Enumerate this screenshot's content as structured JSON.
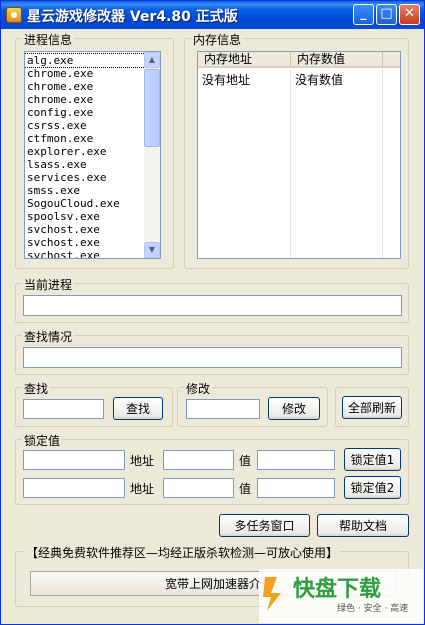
{
  "window": {
    "title": "星云游戏修改器 Ver4.80 正式版",
    "controls": {
      "minimize": "_",
      "maximize": "□",
      "close": "✕"
    }
  },
  "process_group": {
    "label": "进程信息",
    "selected_index": 0,
    "items": [
      "alg.exe",
      "chrome.exe",
      "chrome.exe",
      "chrome.exe",
      "config.exe",
      "csrss.exe",
      "ctfmon.exe",
      "explorer.exe",
      "lsass.exe",
      "services.exe",
      "smss.exe",
      "SogouCloud.exe",
      "spoolsv.exe",
      "svchost.exe",
      "svchost.exe",
      "svchost.exe"
    ]
  },
  "memory_group": {
    "label": "内存信息",
    "columns": [
      "内存地址",
      "内存数值"
    ],
    "rows": [
      [
        "没有地址",
        "没有数值"
      ]
    ]
  },
  "current_process": {
    "label": "当前进程",
    "value": ""
  },
  "search_status": {
    "label": "查找情况",
    "value": ""
  },
  "search": {
    "label": "查找",
    "value": "",
    "button": "查找"
  },
  "modify": {
    "label": "修改",
    "value": "",
    "button": "修改"
  },
  "refresh_all": {
    "label": "全部刷新"
  },
  "lock": {
    "label": "锁定值",
    "address_label": "地址",
    "value_label": "值",
    "rows": [
      {
        "name": "",
        "address": "",
        "value": "",
        "button": "锁定值1"
      },
      {
        "name": "",
        "address": "",
        "value": "",
        "button": "锁定值2"
      }
    ]
  },
  "multitask_window": {
    "label": "多任务窗口"
  },
  "help_doc": {
    "label": "帮助文档"
  },
  "promo": {
    "label": "【经典免费软件推荐区—均经正版杀软检测—可放心使用】",
    "link": "宽带上网加速器介"
  },
  "watermark": {
    "brand": "快盘下载",
    "tagline": "绿色 · 安全 · 高速",
    "accent": "#2E9E3C"
  }
}
